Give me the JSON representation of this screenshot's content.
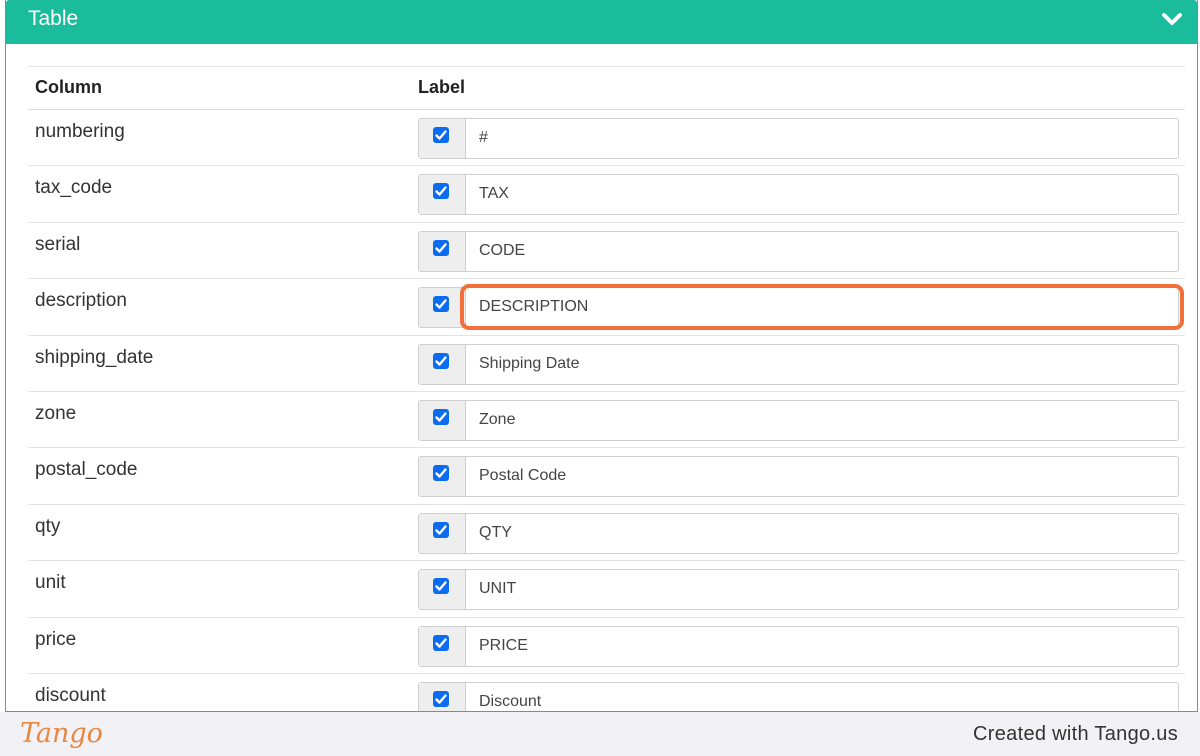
{
  "panel": {
    "title": "Table",
    "header_color": "#1abc9c",
    "toggle_icon": "chevron-down-icon"
  },
  "table": {
    "headers": {
      "column": "Column",
      "label": "Label"
    },
    "rows": [
      {
        "column": "numbering",
        "checked": true,
        "label": "#"
      },
      {
        "column": "tax_code",
        "checked": true,
        "label": "TAX"
      },
      {
        "column": "serial",
        "checked": true,
        "label": "CODE"
      },
      {
        "column": "description",
        "checked": true,
        "label": "DESCRIPTION"
      },
      {
        "column": "shipping_date",
        "checked": true,
        "label": "Shipping Date"
      },
      {
        "column": "zone",
        "checked": true,
        "label": "Zone"
      },
      {
        "column": "postal_code",
        "checked": true,
        "label": "Postal Code"
      },
      {
        "column": "qty",
        "checked": true,
        "label": "QTY"
      },
      {
        "column": "unit",
        "checked": true,
        "label": "UNIT"
      },
      {
        "column": "price",
        "checked": true,
        "label": "PRICE"
      },
      {
        "column": "discount",
        "checked": true,
        "label": "Discount"
      }
    ]
  },
  "highlight": {
    "color": "#f26f3a",
    "target_row": "description"
  },
  "footer": {
    "logo": "Tango",
    "credit": "Created with Tango.us"
  }
}
